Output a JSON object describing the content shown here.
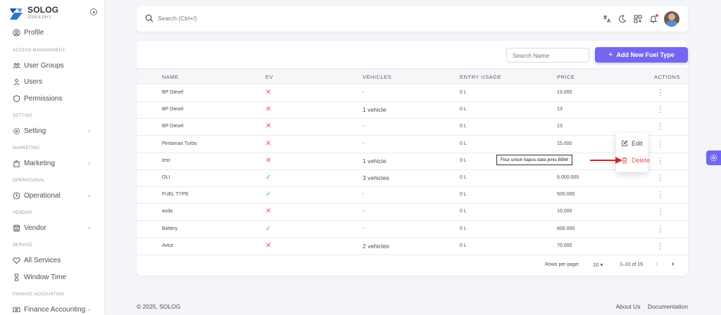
{
  "brand": {
    "name": "SOLOG",
    "version": "2024.6.14+1"
  },
  "sidebar": {
    "profile": "Profile",
    "sections": {
      "access": "ACCESS MANAGEMENT",
      "setting": "SETTING",
      "marketing": "MARKETING",
      "operational": "OPERATIONAL",
      "vendor": "VENDOR",
      "service": "SERVICE",
      "finance": "FINANCE ACCOUNTING"
    },
    "items": {
      "user_groups": "User Groups",
      "users": "Users",
      "permissions": "Permissions",
      "setting": "Setting",
      "marketing": "Marketing",
      "operational": "Operational",
      "vendor": "Vendor",
      "all_services": "All Services",
      "window_time": "Window Time",
      "finance_accounting": "Finance Accounting"
    }
  },
  "search": {
    "placeholder": "Search (Ctrl+/)"
  },
  "toolbar": {
    "name_search_placeholder": "Search Name",
    "add_label": "Add New Fuel Type"
  },
  "table": {
    "headers": {
      "name": "NAME",
      "ev": "EV",
      "vehicles": "VEHICLES",
      "entry_usage": "ENTRY USAGE",
      "price": "PRICE",
      "actions": "ACTIONS"
    },
    "rows": [
      {
        "name": "BP Diesel",
        "ev": false,
        "vehicles": "-",
        "entry_usage": "0 L",
        "price": "13.000"
      },
      {
        "name": "BP Diesel",
        "ev": false,
        "vehicles": "1 vehicle",
        "entry_usage": "0 L",
        "price": "13"
      },
      {
        "name": "BP Diesel",
        "ev": false,
        "vehicles": "-",
        "entry_usage": "0 L",
        "price": "13"
      },
      {
        "name": "Pertamax Turbo",
        "ev": false,
        "vehicles": "-",
        "entry_usage": "0 L",
        "price": "15.000"
      },
      {
        "name": "test",
        "ev": false,
        "vehicles": "1 vehicle",
        "entry_usage": "0 L",
        "price": ""
      },
      {
        "name": "OLI",
        "ev": true,
        "vehicles": "3 vehicles",
        "entry_usage": "0 L",
        "price": "6.000.000"
      },
      {
        "name": "FUEL TYPE",
        "ev": true,
        "vehicles": "-",
        "entry_usage": "0 L",
        "price": "500.000"
      },
      {
        "name": "asda",
        "ev": false,
        "vehicles": "-",
        "entry_usage": "0 L",
        "price": "10.000"
      },
      {
        "name": "Battery",
        "ev": true,
        "vehicles": "-",
        "entry_usage": "0 L",
        "price": "600.000"
      },
      {
        "name": "Avtur",
        "ev": false,
        "vehicles": "2 vehicles",
        "entry_usage": "0 L",
        "price": "70.000"
      }
    ]
  },
  "pagination": {
    "rows_per_page_label": "Rows per page:",
    "rows_per_page": "10",
    "range": "1–10 of 16"
  },
  "menu": {
    "edit": "Edit",
    "delete": "Delete"
  },
  "annotation": {
    "tooltip": "Fitur untuk hapus data jenis BBM"
  },
  "footer": {
    "copyright": "© 2025, SOLOG",
    "about": "About Us",
    "docs": "Documentation"
  },
  "colors": {
    "primary": "#7367f0",
    "danger": "#ea5455",
    "success": "#28c76f"
  }
}
